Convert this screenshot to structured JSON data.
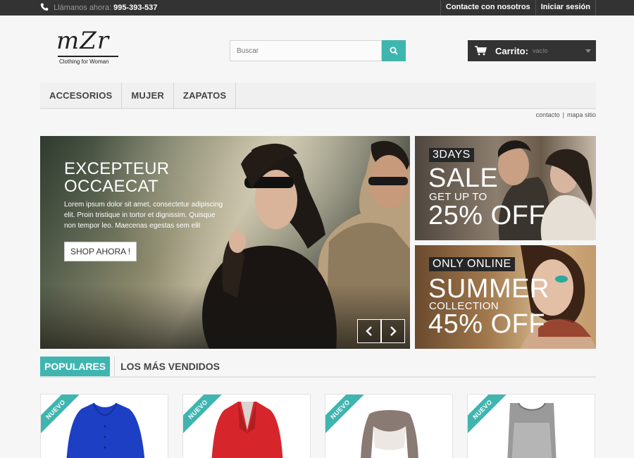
{
  "topbar": {
    "phone_label": "Llámanos ahora:",
    "phone_number": "995-393-537",
    "links": [
      "Contacte con nosotros",
      "Iniciar sesión"
    ]
  },
  "logo": {
    "mark": "mZr",
    "tagline": "Clothing for Woman"
  },
  "search": {
    "placeholder": "Buscar"
  },
  "cart": {
    "label": "Carrito:",
    "status": "vacío"
  },
  "menu": {
    "items": [
      "ACCESORIOS",
      "MUJER",
      "ZAPATOS"
    ]
  },
  "sublinks": {
    "contact": "contacto",
    "separator": "|",
    "sitemap": "mapa sitio"
  },
  "slider": {
    "title": "EXCEPTEUR\nOCCAECAT",
    "body": "Lorem ipsum dolor sit amet, consectetur adipiscing elit. Proin tristique in tortor et dignissim. Quisque non tempor leo. Maecenas egestas sem elit",
    "button": "SHOP AHORA !"
  },
  "promos": [
    {
      "tag": "3DAYS",
      "big": "SALE",
      "mid": "GET UP TO",
      "discount": "25% OFF"
    },
    {
      "tag": "ONLY ONLINE",
      "big": "SUMMER",
      "mid": "COLLECTION",
      "discount": "45% OFF"
    }
  ],
  "tabs": {
    "active": "POPULARES",
    "other": "LOS MÁS VENDIDOS"
  },
  "products": [
    {
      "badge": "NUEVO",
      "color": "#1c3fc4"
    },
    {
      "badge": "NUEVO",
      "color": "#d6262c"
    },
    {
      "badge": "NUEVO",
      "color": "#8a7a74"
    },
    {
      "badge": "NUEVO",
      "color": "#9a9a9a"
    }
  ],
  "colors": {
    "accent": "#3fb5b0",
    "dark": "#333333"
  }
}
